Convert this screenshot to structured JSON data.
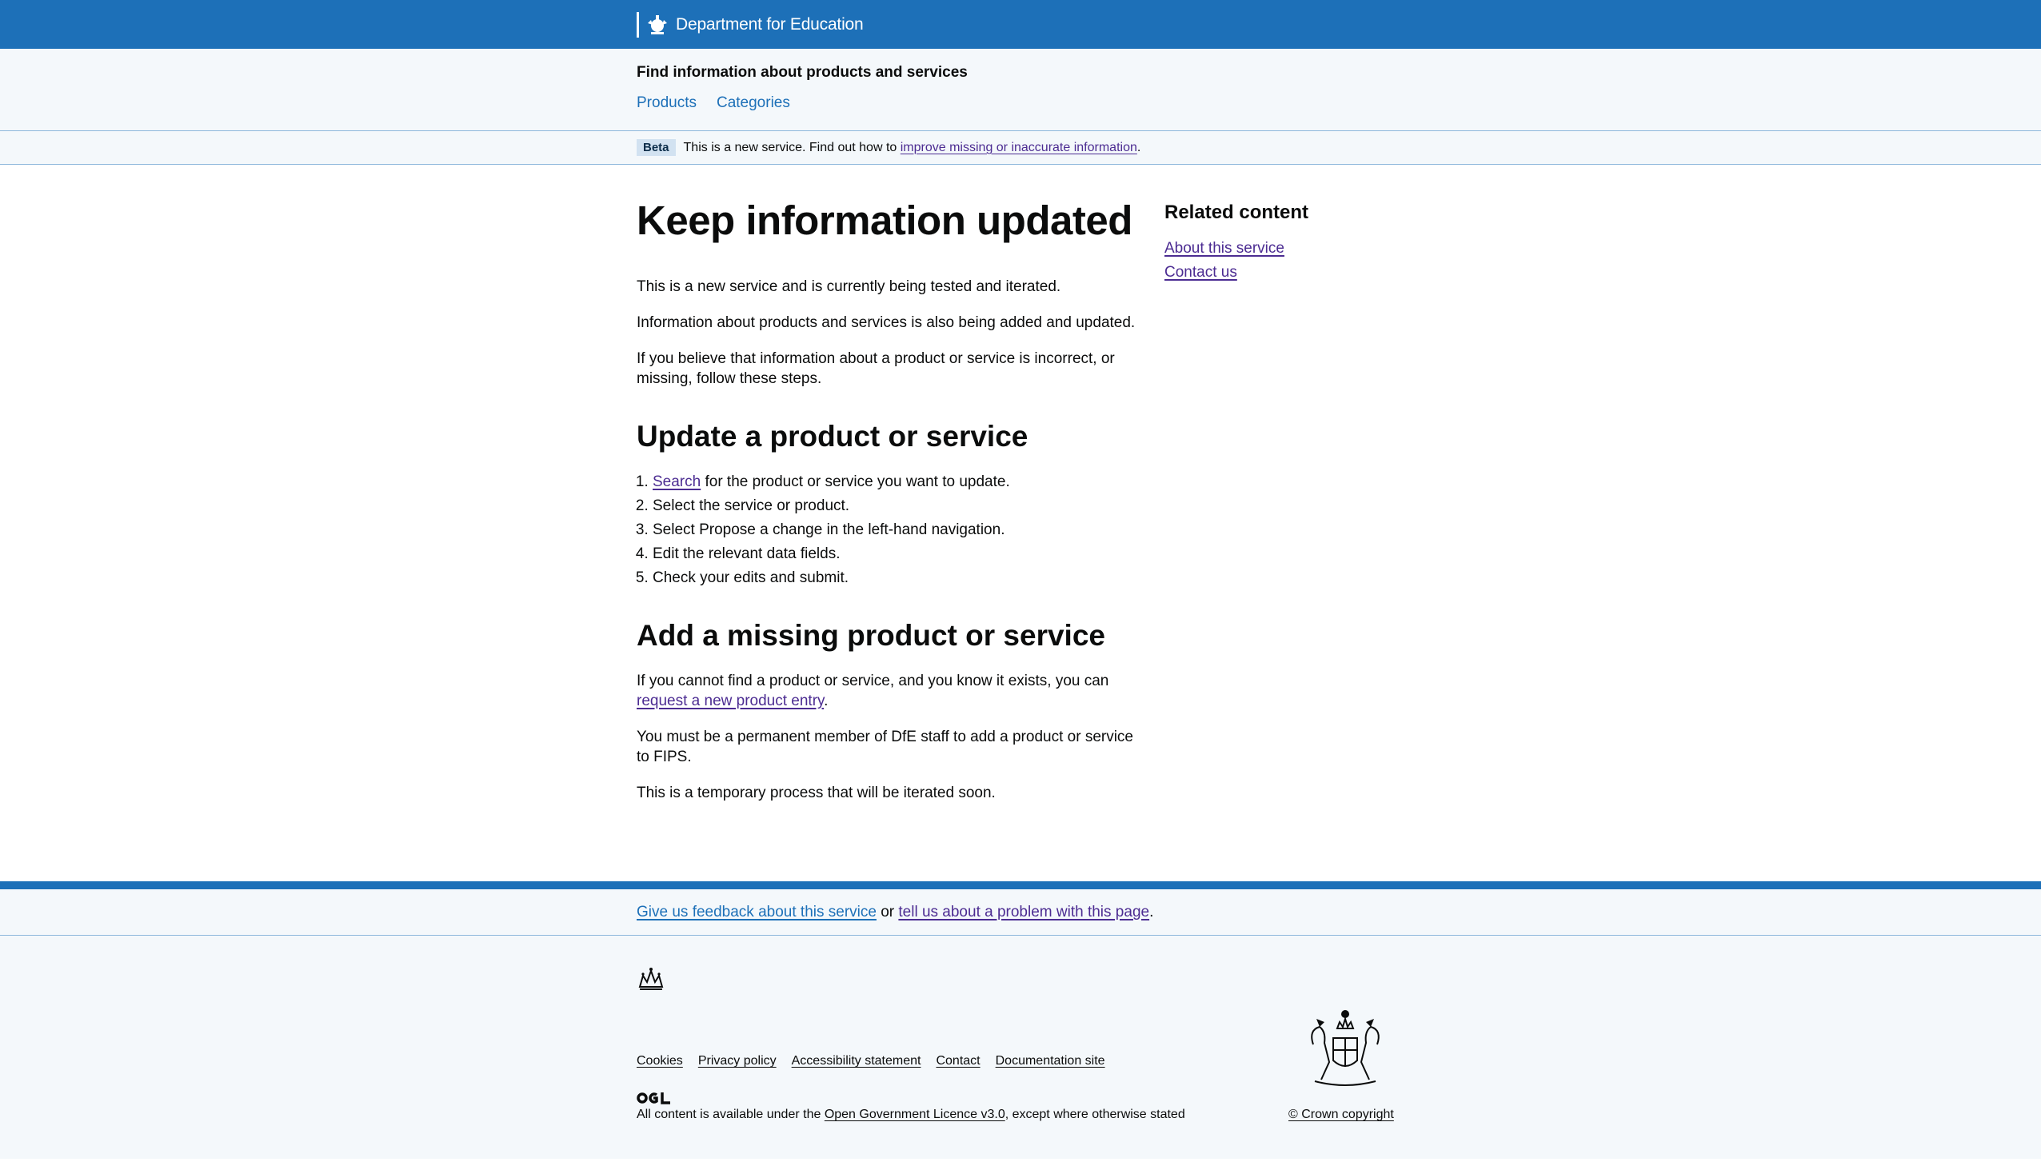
{
  "header": {
    "department": "Department for Education",
    "service_name": "Find information about products and services",
    "nav": [
      "Products",
      "Categories"
    ]
  },
  "phase_banner": {
    "tag": "Beta",
    "text": "This is a new service. Find out how to",
    "link": "improve missing or inaccurate information",
    "end": "."
  },
  "main": {
    "title": "Keep information updated",
    "intro": [
      "This is a new service and is currently being tested and iterated.",
      "Information about products and services is also being added and updated.",
      "If you believe that information about a product or service is incorrect, or missing, follow these steps."
    ],
    "update_heading": "Update a product or service",
    "steps": {
      "step1_link": "Search",
      "step1_text": " for the product or service you want to update.",
      "step2": "Select the service or product.",
      "step3": "Select Propose a change in the left-hand navigation.",
      "step4": "Edit the relevant data fields.",
      "step5": "Check your edits and submit."
    },
    "add_heading": "Add a missing product or service",
    "add_para1_text": "If you cannot find a product or service, and you know it exists, you can ",
    "add_para1_link": "request a new product entry",
    "add_para1_end": ".",
    "add_para2": "You must be a permanent member of DfE staff to add a product or service to FIPS.",
    "add_para3": "This is a temporary process that will be iterated soon."
  },
  "aside": {
    "title": "Related content",
    "links": [
      "About this service",
      "Contact us"
    ]
  },
  "feedback": {
    "link1": "Give us feedback about this service",
    "middle": " or ",
    "link2": "tell us about a problem with this page",
    "end": "."
  },
  "footer": {
    "links": [
      "Cookies",
      "Privacy policy",
      "Accessibility statement",
      "Contact",
      "Documentation site"
    ],
    "licence_text": "All content is available under the ",
    "licence_link": "Open Government Licence v3.0",
    "licence_end": ", except where otherwise stated",
    "copyright": "© Crown copyright"
  },
  "colors": {
    "brand_blue": "#1d70b8",
    "link_visited": "#4c2c92",
    "background_light": "#f4f8fb"
  }
}
